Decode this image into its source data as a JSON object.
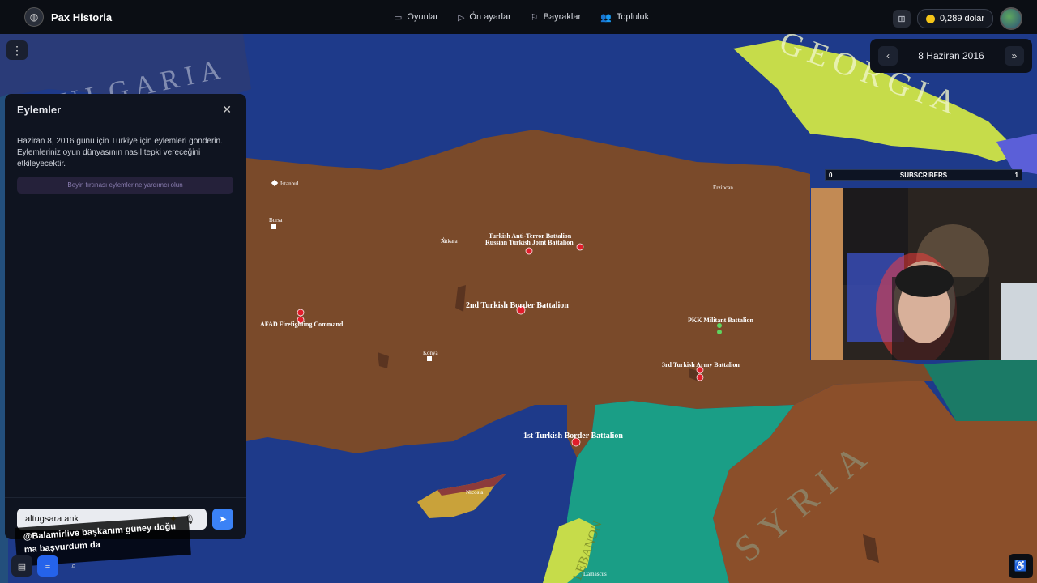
{
  "app": {
    "name": "Pax Historia"
  },
  "nav": {
    "items": [
      {
        "label": "Oyunlar",
        "icon": "gamepad-icon"
      },
      {
        "label": "Ön ayarlar",
        "icon": "play-icon"
      },
      {
        "label": "Bayraklar",
        "icon": "flag-icon"
      },
      {
        "label": "Topluluk",
        "icon": "users-icon"
      }
    ]
  },
  "header": {
    "balance": "0,289 dolar",
    "gift_icon": "gift-icon"
  },
  "date_bar": {
    "date": "8 Haziran 2016"
  },
  "panel": {
    "title": "Eylemler",
    "description": "Haziran 8, 2016 günü için Türkiye için eylemleri gönderin. Eylemleriniz oyun dünyasının nasıl tepki vereceğini etkileyecektir.",
    "brainstorm_label": "Beyin fırtınası eylemlerine yardımcı olun",
    "input_value": "altugsara ank"
  },
  "chat_overlay": {
    "line1": "@Balamirlive başkanım güney doğu",
    "line2": "ma başvurdum da"
  },
  "subscribers": {
    "label": "SUBSCRIBERS",
    "left": "0",
    "right": "1"
  },
  "map": {
    "countries": [
      "BULGARIA",
      "GEORGIA",
      "SYRIA",
      "LEBANON"
    ],
    "cities": [
      "Istanbul",
      "Ankara",
      "Konya",
      "Nicosia",
      "Damascus",
      "Bursa",
      "Erzincan"
    ],
    "units": [
      "Turkish Anti-Terror Battalion",
      "Russian Turkish Joint Battalion",
      "2nd Turkish Border Battalion",
      "AFAD Firefighting Command",
      "PKK Militant Battalion",
      "3rd Turkish Army Battalion",
      "1st Turkish Border Battalion"
    ],
    "colors": {
      "sea": "#1e3a8a",
      "turkey": "#7a4a2a",
      "syria": "#8b4f2a",
      "georgia": "#c6dc4a",
      "green_region": "#1a9e86"
    }
  }
}
